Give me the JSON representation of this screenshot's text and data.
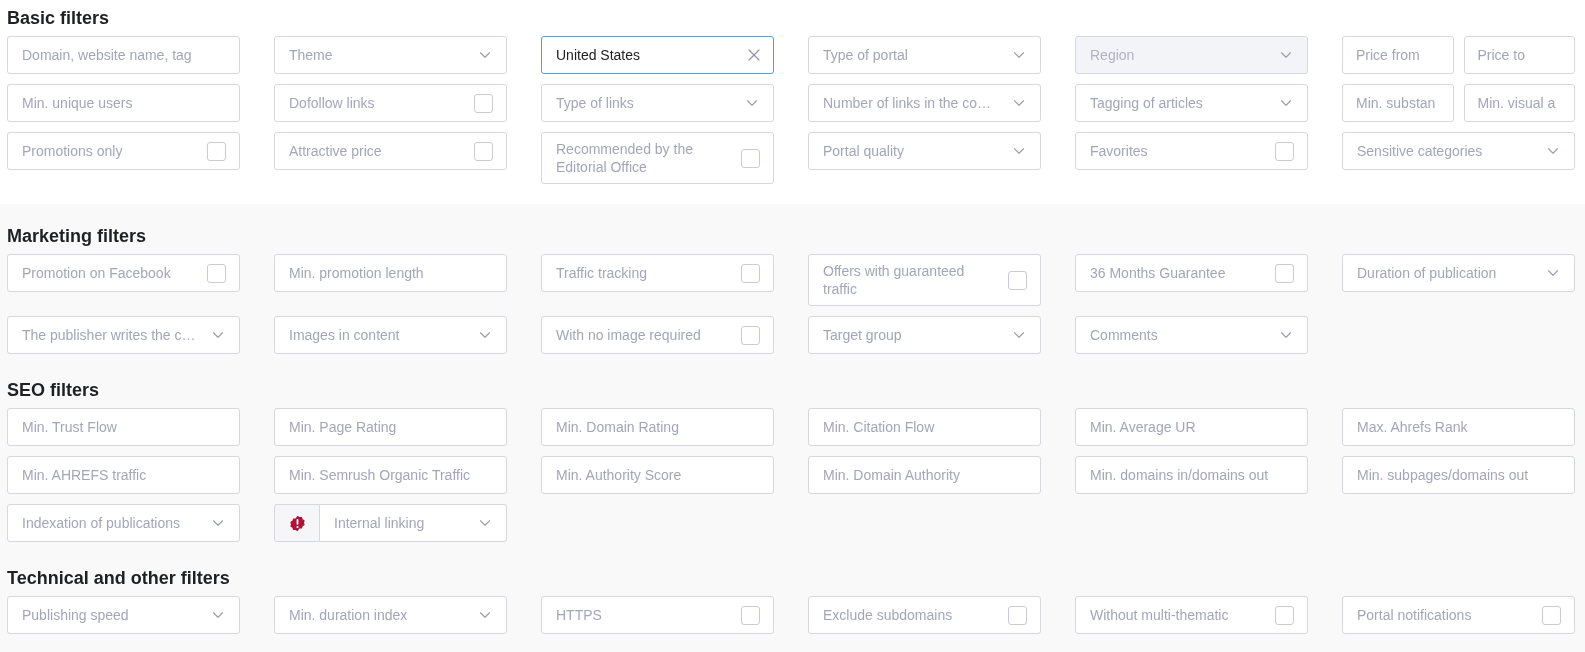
{
  "sections": [
    {
      "title": "Basic filters",
      "shaded": false,
      "rows": [
        {
          "fields": [
            {
              "kind": "text",
              "placeholder": "Domain, website name, tag"
            },
            {
              "kind": "select",
              "label": "Theme",
              "disabled": false,
              "flagged": false
            },
            {
              "kind": "value",
              "value": "United States"
            },
            {
              "kind": "select",
              "label": "Type of portal",
              "disabled": false,
              "flagged": false
            },
            {
              "kind": "select",
              "label": "Region",
              "disabled": true,
              "flagged": false
            },
            {
              "kind": "pair",
              "parts": [
                {
                  "placeholder": "Price from"
                },
                {
                  "placeholder": "Price to"
                }
              ]
            }
          ]
        },
        {
          "fields": [
            {
              "kind": "text",
              "placeholder": "Min. unique users"
            },
            {
              "kind": "checkbox",
              "label": "Dofollow links",
              "checked": false
            },
            {
              "kind": "select",
              "label": "Type of links",
              "disabled": false,
              "flagged": false
            },
            {
              "kind": "select",
              "label": "Number of links in the co…",
              "disabled": false,
              "flagged": false
            },
            {
              "kind": "select",
              "label": "Tagging of articles",
              "disabled": false,
              "flagged": false
            },
            {
              "kind": "pair",
              "parts": [
                {
                  "placeholder": "Min. substan"
                },
                {
                  "placeholder": "Min. visual a"
                }
              ]
            }
          ]
        },
        {
          "fields": [
            {
              "kind": "checkbox",
              "label": "Promotions only",
              "checked": false
            },
            {
              "kind": "checkbox",
              "label": "Attractive price",
              "checked": false
            },
            {
              "kind": "checkbox",
              "label": "Recommended by the Editorial Office",
              "checked": false
            },
            {
              "kind": "select",
              "label": "Portal quality",
              "disabled": false,
              "flagged": false
            },
            {
              "kind": "checkbox",
              "label": "Favorites",
              "checked": false
            },
            {
              "kind": "select",
              "label": "Sensitive categories",
              "disabled": false,
              "flagged": false
            }
          ]
        }
      ]
    },
    {
      "title": "Marketing filters",
      "shaded": true,
      "rows": [
        {
          "fields": [
            {
              "kind": "checkbox",
              "label": "Promotion on Facebook",
              "checked": false
            },
            {
              "kind": "text",
              "placeholder": "Min. promotion length"
            },
            {
              "kind": "checkbox",
              "label": "Traffic tracking",
              "checked": false
            },
            {
              "kind": "checkbox",
              "label": "Offers with guaranteed traffic",
              "checked": false
            },
            {
              "kind": "checkbox",
              "label": "36 Months Guarantee",
              "checked": false
            },
            {
              "kind": "select",
              "label": "Duration of publication",
              "disabled": false,
              "flagged": false
            }
          ]
        },
        {
          "fields": [
            {
              "kind": "select",
              "label": "The publisher writes the c…",
              "disabled": false,
              "flagged": false
            },
            {
              "kind": "select",
              "label": "Images in content",
              "disabled": false,
              "flagged": false
            },
            {
              "kind": "checkbox",
              "label": "With no image required",
              "checked": false
            },
            {
              "kind": "select",
              "label": "Target group",
              "disabled": false,
              "flagged": false
            },
            {
              "kind": "select",
              "label": "Comments",
              "disabled": false,
              "flagged": false
            }
          ]
        }
      ]
    },
    {
      "title": "SEO filters",
      "shaded": true,
      "rows": [
        {
          "fields": [
            {
              "kind": "text",
              "placeholder": "Min. Trust Flow"
            },
            {
              "kind": "text",
              "placeholder": "Min. Page Rating"
            },
            {
              "kind": "text",
              "placeholder": "Min. Domain Rating"
            },
            {
              "kind": "text",
              "placeholder": "Min. Citation Flow"
            },
            {
              "kind": "text",
              "placeholder": "Min. Average UR"
            },
            {
              "kind": "text",
              "placeholder": "Max. Ahrefs Rank"
            }
          ]
        },
        {
          "fields": [
            {
              "kind": "text",
              "placeholder": "Min. AHREFS traffic"
            },
            {
              "kind": "text",
              "placeholder": "Min. Semrush Organic Traffic"
            },
            {
              "kind": "text",
              "placeholder": "Min. Authority Score"
            },
            {
              "kind": "text",
              "placeholder": "Min. Domain Authority"
            },
            {
              "kind": "text",
              "placeholder": "Min. domains in/domains out"
            },
            {
              "kind": "text",
              "placeholder": "Min. subpages/domains out"
            }
          ]
        },
        {
          "fields": [
            {
              "kind": "select",
              "label": "Indexation of publications",
              "disabled": false,
              "flagged": false
            },
            {
              "kind": "select",
              "label": "Internal linking",
              "disabled": false,
              "flagged": true
            }
          ]
        }
      ]
    },
    {
      "title": "Technical and other filters",
      "shaded": true,
      "rows": [
        {
          "fields": [
            {
              "kind": "select",
              "label": "Publishing speed",
              "disabled": false,
              "flagged": false
            },
            {
              "kind": "select",
              "label": "Min. duration index",
              "disabled": false,
              "flagged": false
            },
            {
              "kind": "checkbox",
              "label": "HTTPS",
              "checked": false
            },
            {
              "kind": "checkbox",
              "label": "Exclude subdomains",
              "checked": false
            },
            {
              "kind": "checkbox",
              "label": "Without multi-thematic",
              "checked": false
            },
            {
              "kind": "checkbox",
              "label": "Portal notifications",
              "checked": false
            }
          ]
        }
      ]
    }
  ]
}
